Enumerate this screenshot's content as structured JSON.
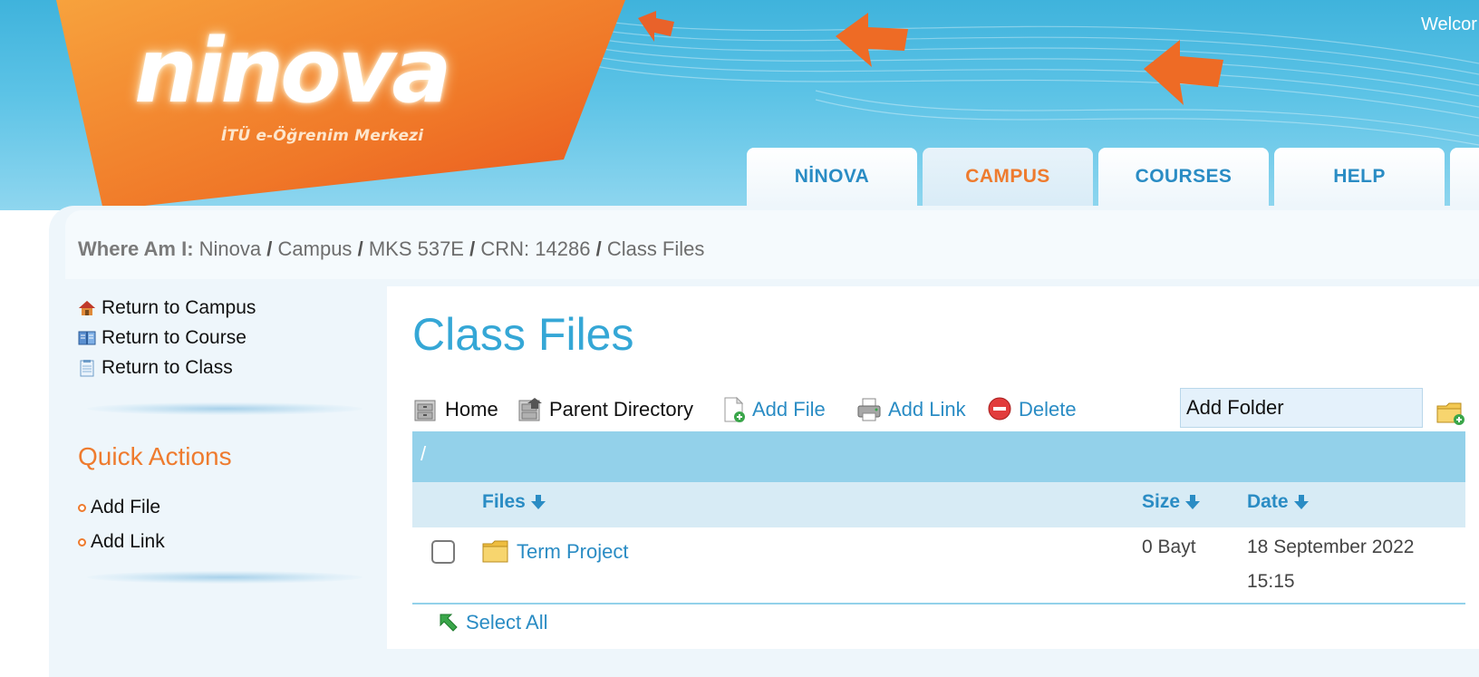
{
  "header": {
    "logo": "ninova",
    "logo_subtitle": "İTÜ e-Öğrenim Merkezi",
    "welcome": "Welcor"
  },
  "tabs": [
    {
      "label": "NİNOVA",
      "active": false
    },
    {
      "label": "CAMPUS",
      "active": true
    },
    {
      "label": "COURSES",
      "active": false
    },
    {
      "label": "HELP",
      "active": false
    }
  ],
  "breadcrumb": {
    "label": "Where Am I:",
    "items": [
      "Ninova",
      "Campus",
      "MKS 537E",
      "CRN: 14286",
      "Class Files"
    ],
    "separator": "/"
  },
  "sidebar": {
    "links": [
      {
        "label": "Return to Campus",
        "icon": "house-icon"
      },
      {
        "label": "Return to Course",
        "icon": "book-icon"
      },
      {
        "label": "Return to Class",
        "icon": "notepad-icon"
      }
    ],
    "quick_actions_title": "Quick Actions",
    "quick_actions": [
      "Add File",
      "Add Link"
    ]
  },
  "main": {
    "title": "Class Files",
    "toolbar": {
      "home": "Home",
      "parent_directory": "Parent Directory",
      "add_file": "Add File",
      "add_link": "Add Link",
      "delete": "Delete"
    },
    "folder_input_value": "Add Folder",
    "path": "/",
    "columns": {
      "files": "Files",
      "size": "Size",
      "date": "Date"
    },
    "rows": [
      {
        "name": "Term Project",
        "type": "folder",
        "size": "0 Bayt",
        "date": "18 September 2022",
        "time": "15:15"
      }
    ],
    "select_all": "Select All"
  },
  "colors": {
    "accent_orange": "#ee7b2e",
    "link_blue": "#2a8cc4",
    "title_blue": "#35a7d6",
    "header_sky": "#4fbde3"
  }
}
